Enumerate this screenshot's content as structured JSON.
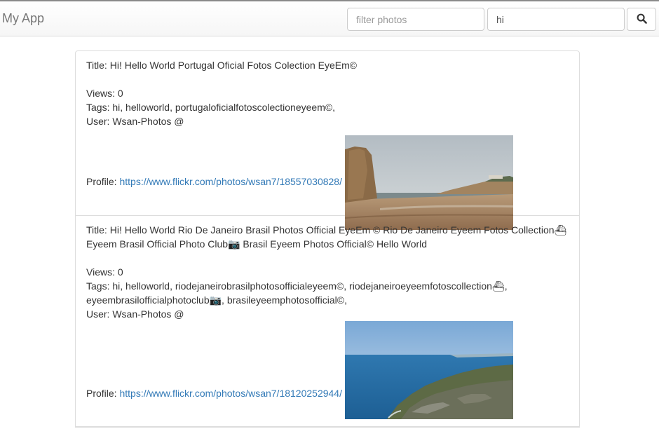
{
  "app": {
    "brand": "My App"
  },
  "search": {
    "filter_placeholder": "filter photos",
    "filter_value": "",
    "query_value": "hi",
    "button_icon": "search-icon"
  },
  "photos": [
    {
      "title_label": "Title:",
      "title": "Hi! Hello World Portugal Oficial Fotos Colection EyeEm©",
      "views_label": "Views:",
      "views": "0",
      "tags_label": "Tags:",
      "tags": "hi, helloworld, portugaloficialfotoscolectioneyeem©,",
      "user_label": "User:",
      "user": "Wsan-Photos @",
      "profile_label": "Profile:",
      "profile_url": "https://www.flickr.com/photos/wsan7/18557030828/",
      "image": "beach-cliff-photo"
    },
    {
      "title_label": "Title:",
      "title": "Hi! Hello World Rio De Janeiro Brasil Photos Official EyeEm © Rio De Janeiro Eyeem Fotos Collection⛴ Eyeem Brasil Official Photo Club📷 Brasil Eyeem Photos Official© Hello World",
      "views_label": "Views:",
      "views": "0",
      "tags_label": "Tags:",
      "tags": "hi, helloworld, riodejaneirobrasilphotosofficialeyeem©, riodejaneiroeyeemfotoscollection⛴, eyeembrasilofficialphotoclub📷, brasileyeemphotosofficial©,",
      "user_label": "User:",
      "user": "Wsan-Photos @",
      "profile_label": "Profile:",
      "profile_url": "https://www.flickr.com/photos/wsan7/18120252944/",
      "image": "coast-cliff-photo"
    }
  ]
}
